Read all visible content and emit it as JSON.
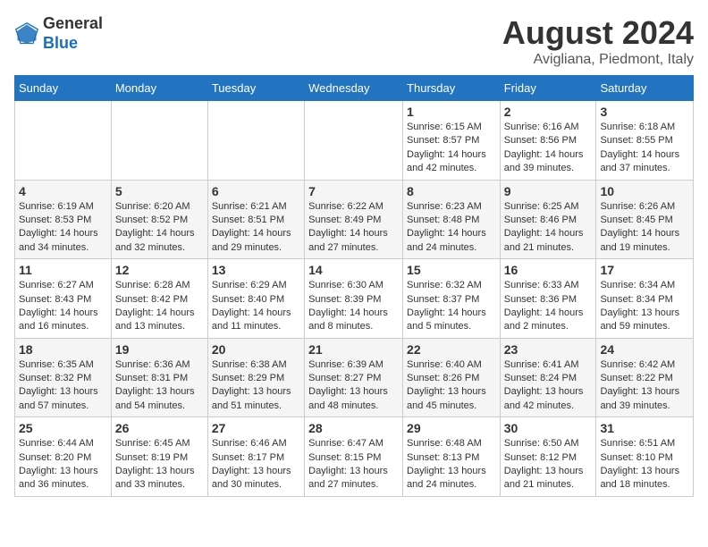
{
  "header": {
    "logo_line1": "General",
    "logo_line2": "Blue",
    "month": "August 2024",
    "location": "Avigliana, Piedmont, Italy"
  },
  "days_of_week": [
    "Sunday",
    "Monday",
    "Tuesday",
    "Wednesday",
    "Thursday",
    "Friday",
    "Saturday"
  ],
  "weeks": [
    [
      {
        "day": "",
        "info": ""
      },
      {
        "day": "",
        "info": ""
      },
      {
        "day": "",
        "info": ""
      },
      {
        "day": "",
        "info": ""
      },
      {
        "day": "1",
        "info": "Sunrise: 6:15 AM\nSunset: 8:57 PM\nDaylight: 14 hours and 42 minutes."
      },
      {
        "day": "2",
        "info": "Sunrise: 6:16 AM\nSunset: 8:56 PM\nDaylight: 14 hours and 39 minutes."
      },
      {
        "day": "3",
        "info": "Sunrise: 6:18 AM\nSunset: 8:55 PM\nDaylight: 14 hours and 37 minutes."
      }
    ],
    [
      {
        "day": "4",
        "info": "Sunrise: 6:19 AM\nSunset: 8:53 PM\nDaylight: 14 hours and 34 minutes."
      },
      {
        "day": "5",
        "info": "Sunrise: 6:20 AM\nSunset: 8:52 PM\nDaylight: 14 hours and 32 minutes."
      },
      {
        "day": "6",
        "info": "Sunrise: 6:21 AM\nSunset: 8:51 PM\nDaylight: 14 hours and 29 minutes."
      },
      {
        "day": "7",
        "info": "Sunrise: 6:22 AM\nSunset: 8:49 PM\nDaylight: 14 hours and 27 minutes."
      },
      {
        "day": "8",
        "info": "Sunrise: 6:23 AM\nSunset: 8:48 PM\nDaylight: 14 hours and 24 minutes."
      },
      {
        "day": "9",
        "info": "Sunrise: 6:25 AM\nSunset: 8:46 PM\nDaylight: 14 hours and 21 minutes."
      },
      {
        "day": "10",
        "info": "Sunrise: 6:26 AM\nSunset: 8:45 PM\nDaylight: 14 hours and 19 minutes."
      }
    ],
    [
      {
        "day": "11",
        "info": "Sunrise: 6:27 AM\nSunset: 8:43 PM\nDaylight: 14 hours and 16 minutes."
      },
      {
        "day": "12",
        "info": "Sunrise: 6:28 AM\nSunset: 8:42 PM\nDaylight: 14 hours and 13 minutes."
      },
      {
        "day": "13",
        "info": "Sunrise: 6:29 AM\nSunset: 8:40 PM\nDaylight: 14 hours and 11 minutes."
      },
      {
        "day": "14",
        "info": "Sunrise: 6:30 AM\nSunset: 8:39 PM\nDaylight: 14 hours and 8 minutes."
      },
      {
        "day": "15",
        "info": "Sunrise: 6:32 AM\nSunset: 8:37 PM\nDaylight: 14 hours and 5 minutes."
      },
      {
        "day": "16",
        "info": "Sunrise: 6:33 AM\nSunset: 8:36 PM\nDaylight: 14 hours and 2 minutes."
      },
      {
        "day": "17",
        "info": "Sunrise: 6:34 AM\nSunset: 8:34 PM\nDaylight: 13 hours and 59 minutes."
      }
    ],
    [
      {
        "day": "18",
        "info": "Sunrise: 6:35 AM\nSunset: 8:32 PM\nDaylight: 13 hours and 57 minutes."
      },
      {
        "day": "19",
        "info": "Sunrise: 6:36 AM\nSunset: 8:31 PM\nDaylight: 13 hours and 54 minutes."
      },
      {
        "day": "20",
        "info": "Sunrise: 6:38 AM\nSunset: 8:29 PM\nDaylight: 13 hours and 51 minutes."
      },
      {
        "day": "21",
        "info": "Sunrise: 6:39 AM\nSunset: 8:27 PM\nDaylight: 13 hours and 48 minutes."
      },
      {
        "day": "22",
        "info": "Sunrise: 6:40 AM\nSunset: 8:26 PM\nDaylight: 13 hours and 45 minutes."
      },
      {
        "day": "23",
        "info": "Sunrise: 6:41 AM\nSunset: 8:24 PM\nDaylight: 13 hours and 42 minutes."
      },
      {
        "day": "24",
        "info": "Sunrise: 6:42 AM\nSunset: 8:22 PM\nDaylight: 13 hours and 39 minutes."
      }
    ],
    [
      {
        "day": "25",
        "info": "Sunrise: 6:44 AM\nSunset: 8:20 PM\nDaylight: 13 hours and 36 minutes."
      },
      {
        "day": "26",
        "info": "Sunrise: 6:45 AM\nSunset: 8:19 PM\nDaylight: 13 hours and 33 minutes."
      },
      {
        "day": "27",
        "info": "Sunrise: 6:46 AM\nSunset: 8:17 PM\nDaylight: 13 hours and 30 minutes."
      },
      {
        "day": "28",
        "info": "Sunrise: 6:47 AM\nSunset: 8:15 PM\nDaylight: 13 hours and 27 minutes."
      },
      {
        "day": "29",
        "info": "Sunrise: 6:48 AM\nSunset: 8:13 PM\nDaylight: 13 hours and 24 minutes."
      },
      {
        "day": "30",
        "info": "Sunrise: 6:50 AM\nSunset: 8:12 PM\nDaylight: 13 hours and 21 minutes."
      },
      {
        "day": "31",
        "info": "Sunrise: 6:51 AM\nSunset: 8:10 PM\nDaylight: 13 hours and 18 minutes."
      }
    ]
  ]
}
